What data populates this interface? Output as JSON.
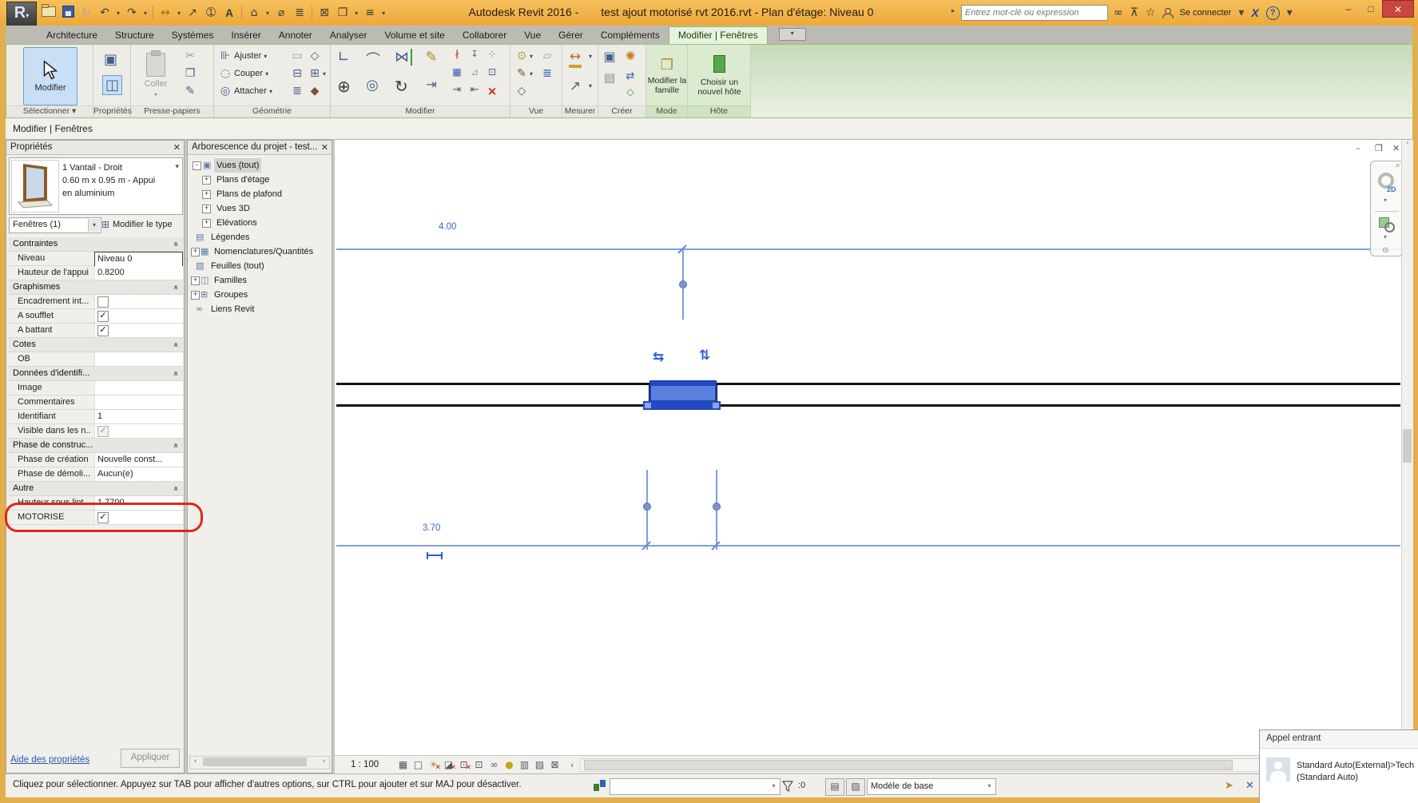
{
  "titlebar": {
    "app_initial": "R",
    "title_app": "Autodesk Revit 2016 -",
    "title_doc": "test ajout motorisé rvt 2016.rvt - Plan d'étage: Niveau 0",
    "search_placeholder": "Entrez mot-clé ou expression",
    "sign_in": "Se connecter"
  },
  "tabs": [
    "Architecture",
    "Structure",
    "Systèmes",
    "Insérer",
    "Annoter",
    "Analyser",
    "Volume et site",
    "Collaborer",
    "Vue",
    "Gérer",
    "Compléments"
  ],
  "active_tab": "Modifier | Fenêtres",
  "ribbon": {
    "select_panel": {
      "big_button": "Modifier",
      "label": "Sélectionner"
    },
    "properties_panel": {
      "label": "Propriétés"
    },
    "clipboard_panel": {
      "big_button": "Coller",
      "label": "Presse-papiers"
    },
    "geometry_panel": {
      "label": "Géométrie",
      "buttons": [
        "Ajuster",
        "Couper",
        "Attacher"
      ]
    },
    "modify_panel": {
      "label": "Modifier"
    },
    "view_panel": {
      "label": "Vue"
    },
    "measure_panel": {
      "label": "Mesurer"
    },
    "create_panel": {
      "label": "Créer"
    },
    "mode_panel": {
      "big_button": "Modifier la famille",
      "label": "Mode"
    },
    "host_panel": {
      "big_button": "Choisir un nouvel hôte",
      "label": "Hôte"
    }
  },
  "options_bar": {
    "label": "Modifier | Fenêtres"
  },
  "properties": {
    "header": "Propriétés",
    "type_line1": "1 Vantail - Droit",
    "type_line2": "0.60 m x 0.95 m - Appui",
    "type_line3": "en aluminium",
    "category_filter": "Fenêtres (1)",
    "edit_type": "Modifier le type",
    "rows": [
      {
        "type": "section",
        "label": "Contraintes"
      },
      {
        "type": "text",
        "label": "Niveau",
        "value": "Niveau 0",
        "selected": true
      },
      {
        "type": "text",
        "label": "Hauteur de l'appui",
        "value": "0.8200"
      },
      {
        "type": "section",
        "label": "Graphismes"
      },
      {
        "type": "check",
        "label": "Encadrement int...",
        "checked": false
      },
      {
        "type": "check",
        "label": "A soufflet",
        "checked": true
      },
      {
        "type": "check",
        "label": "A battant",
        "checked": true
      },
      {
        "type": "section",
        "label": "Cotes"
      },
      {
        "type": "text",
        "label": "OB",
        "value": ""
      },
      {
        "type": "section",
        "label": "Données d'identifi..."
      },
      {
        "type": "text",
        "label": "Image",
        "value": ""
      },
      {
        "type": "text",
        "label": "Commentaires",
        "value": ""
      },
      {
        "type": "text",
        "label": "Identifiant",
        "value": "1"
      },
      {
        "type": "check",
        "label": "Visible dans les n...",
        "checked": true,
        "disabled": true
      },
      {
        "type": "section",
        "label": "Phase de construc..."
      },
      {
        "type": "text",
        "label": "Phase de création",
        "value": "Nouvelle const..."
      },
      {
        "type": "text",
        "label": "Phase de démoli...",
        "value": "Aucun(e)"
      },
      {
        "type": "section",
        "label": "Autre"
      },
      {
        "type": "text",
        "label": "Hauteur sous lint...",
        "value": "1.7700"
      },
      {
        "type": "check",
        "label": "MOTORISE",
        "checked": true,
        "highlighted": true
      }
    ],
    "help_link": "Aide des propriétés",
    "apply": "Appliquer"
  },
  "browser": {
    "header": "Arborescence du projet - test...",
    "items": [
      {
        "glyph": "-",
        "label": "Vues (tout)",
        "selected": true
      },
      {
        "glyph": "+",
        "label": "Plans d'étage"
      },
      {
        "glyph": "+",
        "label": "Plans de plafond"
      },
      {
        "glyph": "+",
        "label": "Vues 3D"
      },
      {
        "glyph": "+",
        "label": "Elévations"
      },
      {
        "glyph": "",
        "label": "Légendes"
      },
      {
        "glyph": "+",
        "label": "Nomenclatures/Quantités"
      },
      {
        "glyph": "",
        "label": "Feuilles (tout)"
      },
      {
        "glyph": "+",
        "label": "Familles"
      },
      {
        "glyph": "+",
        "label": "Groupes"
      },
      {
        "glyph": "",
        "label": "Liens Revit"
      }
    ]
  },
  "canvas": {
    "dim_top": "4.00",
    "dim_bottom": "3.70"
  },
  "view_bar": {
    "scale": "1 : 100"
  },
  "status_bar": {
    "hint": "Cliquez pour sélectionner. Appuyez sur TAB pour afficher d'autres options, sur CTRL pour ajouter et sur MAJ pour désactiver.",
    "selection_count": ":0",
    "design_option": "Modèle de base"
  },
  "notification": {
    "title": "Appel entrant",
    "line1": "Standard Auto(External)>Tech",
    "line2": "(Standard Auto)"
  },
  "colors": {
    "titlebar_amber": "#eca938",
    "contextual_green": "#cfe3c2",
    "selection_blue": "#2b5cd8",
    "dimension_blue": "#7d9ee3",
    "annotation_red": "#e0261c"
  },
  "icons": {
    "caret": "▾",
    "caret_right": "▸",
    "caret_left": "◂",
    "chevron_left": "‹",
    "close": "✕",
    "minimize": "–",
    "maximize": "□",
    "restore": "❐",
    "section_collapse": "«",
    "up": "˄",
    "down": "˅",
    "undo": "↶",
    "redo": "↷",
    "sync": "↻",
    "measure_arrow": "↔",
    "dim_diag": "↗",
    "tag": "➀",
    "text_a": "A",
    "home_3d": "⌂",
    "section_sym": "⌀",
    "thin_lines": "≣",
    "close_windows": "⊠",
    "switch_windows": "❐",
    "menu": "≡",
    "binoculars": "∞",
    "satellite": "⊼",
    "star": "☆",
    "exchange": "X",
    "help": "?",
    "scissors": "✂",
    "copy": "❐",
    "match_brush": "✎",
    "ajuster": "⊪",
    "couper": "◌",
    "attacher": "◎",
    "hammer": "◆",
    "join": "⊞",
    "beam": "⊟",
    "demolir": "◇",
    "profil": "▭",
    "align": "∟",
    "offset": "⌒",
    "mirror_axis": "⋈",
    "mirror_draw": "✎",
    "move": "⊕",
    "copy_move": "◎",
    "rotate": "↻",
    "trim": "⇥",
    "extend": "⇤",
    "array": "▦",
    "scale_tool": "⊿",
    "split": "∤",
    "pin": "↧",
    "unpin": "⊹",
    "delete": "×",
    "bulb": "⊙",
    "box_grey": "▱",
    "brush": "✎",
    "underlay": "≣",
    "box3d": "◇",
    "group": "▣",
    "sunburst": "✺",
    "layers": "▤",
    "similar": "◇",
    "arrows_sm": "⇄",
    "detail_level": "▦",
    "visual_style": "□",
    "sun_small": "☀",
    "shadow": "◪",
    "crop": "⊡",
    "glasses": "∞",
    "reveal": "●",
    "temp_props": "▥",
    "displace": "▨",
    "lock": "⊠",
    "off_x": "✕",
    "flip_h": "⇆",
    "flip_v": "⇅",
    "tree_vues": "▣",
    "tree_legendes": "▤",
    "tree_nomenclatures": "▦",
    "tree_feuilles": "▧",
    "tree_familles": "◫",
    "tree_groupes": "⊞",
    "tree_liens": "∞",
    "wheel_2d": "2D",
    "nav_close": "✕",
    "nav_minus": "⊖",
    "edit_type_icon": "⊞",
    "pointer_link": "➤",
    "filter_x": "✕"
  }
}
